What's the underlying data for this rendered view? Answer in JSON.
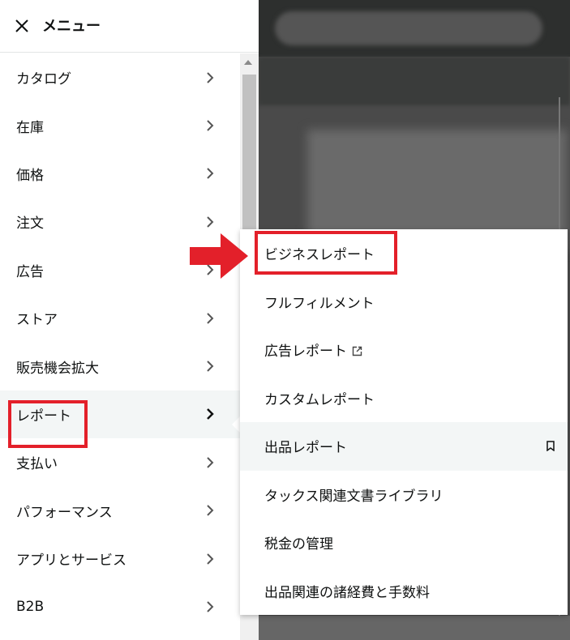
{
  "header": {
    "title": "メニュー"
  },
  "menu": {
    "items": [
      {
        "label": "カタログ"
      },
      {
        "label": "在庫"
      },
      {
        "label": "価格"
      },
      {
        "label": "注文"
      },
      {
        "label": "広告"
      },
      {
        "label": "ストア"
      },
      {
        "label": "販売機会拡大"
      },
      {
        "label": "レポート"
      },
      {
        "label": "支払い"
      },
      {
        "label": "パフォーマンス"
      },
      {
        "label": "アプリとサービス"
      },
      {
        "label": "B2B"
      }
    ]
  },
  "submenu": {
    "items": [
      {
        "label": "ビジネスレポート"
      },
      {
        "label": "フルフィルメント"
      },
      {
        "label": "広告レポート"
      },
      {
        "label": "カスタムレポート"
      },
      {
        "label": "出品レポート"
      },
      {
        "label": "タックス関連文書ライブラリ"
      },
      {
        "label": "税金の管理"
      },
      {
        "label": "出品関連の諸経費と手数料"
      }
    ]
  },
  "colors": {
    "highlight": "#e3202a",
    "active_bg": "#f3f6f6",
    "text": "#0f1111"
  }
}
